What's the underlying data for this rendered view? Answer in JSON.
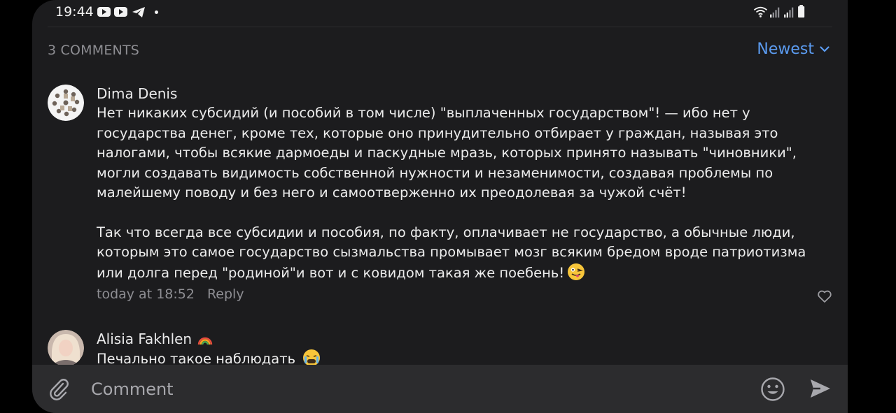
{
  "status_bar": {
    "time": "19:44"
  },
  "header": {
    "count_label": "3 COMMENTS",
    "sort_label": "Newest"
  },
  "comments": [
    {
      "author": "Dima Denis",
      "paragraphs": [
        "Нет никаких субсидий (и пособий в том числе) \"выплаченных государством\"! — ибо нет у государства денег, кроме тех, которые оно принудительно отбирает у граждан, называя это налогами, чтобы всякие дармоеды и паскудные мразь, которых принято называть \"чиновники\", могли создавать видимость собственной нужности и незаменимости, создавая проблемы по малейшему поводу и без него и самоотверженно их преодолевая за чужой счёт!",
        "Так что всегда все субсидии и пособия, по факту, оплачивает не государство, а обычные люди, которым это самое государство сызмальства промывает мозг всяким бредом вроде патриотизма или долга перед \"родиной\"и вот и с ковидом такая же поебень!"
      ],
      "time": "today at 18:52",
      "reply_label": "Reply"
    },
    {
      "author": "Alisia Fakhlen",
      "text": "Печально такое наблюдать"
    }
  ],
  "input": {
    "placeholder": "Comment"
  },
  "colors": {
    "background": "#1c1c1e",
    "accent": "#5b9bf0",
    "muted": "#8e8e93",
    "input_bar": "#2c2c2e"
  },
  "icons": [
    "youtube-icon",
    "telegram-icon",
    "wifi-icon",
    "signal-icon",
    "battery-icon",
    "chevron-down-icon",
    "heart-icon",
    "rainbow-icon",
    "paperclip-icon",
    "emoji-icon",
    "send-icon"
  ]
}
